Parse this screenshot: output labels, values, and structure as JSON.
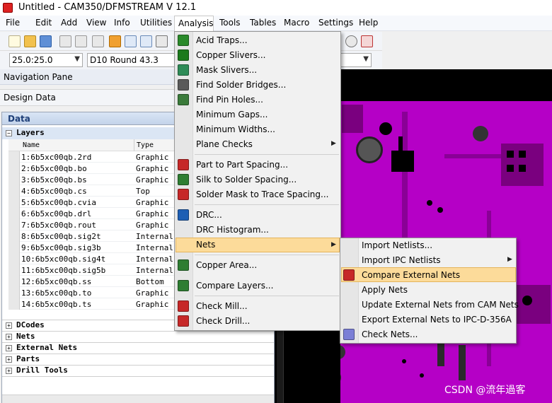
{
  "window": {
    "title": "Untitled - CAM350/DFMSTREAM V 12.1"
  },
  "menubar": {
    "items": [
      "File",
      "Edit",
      "Add",
      "View",
      "Info",
      "Utilities",
      "Analysis",
      "Tools",
      "Tables",
      "Macro",
      "Settings",
      "Help"
    ],
    "active": "Analysis"
  },
  "toolbar": {
    "layer_value": "25.0:25.0",
    "dcode_value": "D10  Round 43.3"
  },
  "navigation": {
    "title": "Navigation Pane",
    "design_data": "Design Data",
    "data_header": "Data"
  },
  "layers": {
    "label": "Layers",
    "columns": [
      "Name",
      "Type"
    ],
    "rows": [
      {
        "name": "1:6b5xc00qb.2rd",
        "type": "Graphic"
      },
      {
        "name": "2:6b5xc00qb.bo",
        "type": "Graphic"
      },
      {
        "name": "3:6b5xc00qb.bs",
        "type": "Graphic"
      },
      {
        "name": "4:6b5xc00qb.cs",
        "type": "Top"
      },
      {
        "name": "5:6b5xc00qb.cvia",
        "type": "Graphic"
      },
      {
        "name": "6:6b5xc00qb.drl",
        "type": "Graphic"
      },
      {
        "name": "7:6b5xc00qb.rout",
        "type": "Graphic"
      },
      {
        "name": "8:6b5xc00qb.sig2t",
        "type": "Internal"
      },
      {
        "name": "9:6b5xc00qb.sig3b",
        "type": "Internal"
      },
      {
        "name": "10:6b5xc00qb.sig4t",
        "type": "Internal"
      },
      {
        "name": "11:6b5xc00qb.sig5b",
        "type": "Internal"
      },
      {
        "name": "12:6b5xc00qb.ss",
        "type": "Bottom"
      },
      {
        "name": "13:6b5xc00qb.to",
        "type": "Graphic"
      },
      {
        "name": "14:6b5xc00qb.ts",
        "type": "Graphic"
      }
    ]
  },
  "tree_groups": [
    "DCodes",
    "Nets",
    "External Nets",
    "Parts",
    "Drill Tools"
  ],
  "analysis_menu": {
    "items": [
      {
        "label": "Acid Traps...",
        "icon": "acid-trap-icon",
        "color": "#2a8a2a"
      },
      {
        "label": "Copper Slivers...",
        "icon": "copper-sliver-icon",
        "color": "#1c7a1c"
      },
      {
        "label": "Mask Slivers...",
        "icon": "mask-sliver-icon",
        "color": "#2e8b57"
      },
      {
        "label": "Find Solder Bridges...",
        "icon": "solder-bridge-icon",
        "color": "#5a5a5a"
      },
      {
        "label": "Find Pin Holes...",
        "icon": "pin-hole-icon",
        "color": "#3a7a3a"
      },
      {
        "label": "Minimum Gaps...",
        "icon": "",
        "color": ""
      },
      {
        "label": "Minimum Widths...",
        "icon": "",
        "color": ""
      },
      {
        "label": "Plane Checks",
        "icon": "",
        "color": ""
      },
      {
        "label": "Part to Part Spacing...",
        "icon": "part-spacing-icon",
        "color": "#c62828"
      },
      {
        "label": "Silk to Solder Spacing...",
        "icon": "silk-solder-icon",
        "color": "#2e7d32"
      },
      {
        "label": "Solder Mask to Trace Spacing...",
        "icon": "mask-trace-icon",
        "color": "#c62828"
      },
      {
        "label": "DRC...",
        "icon": "drc-icon",
        "color": "#1e5fb4"
      },
      {
        "label": "DRC Histogram...",
        "icon": "",
        "color": ""
      },
      {
        "label": "Nets",
        "icon": "",
        "color": ""
      },
      {
        "label": "Copper Area...",
        "icon": "copper-area-icon",
        "color": "#2e7d32"
      },
      {
        "label": "Compare Layers...",
        "icon": "compare-layers-icon",
        "color": "#2e7d32"
      },
      {
        "label": "Check Mill...",
        "icon": "check-mill-icon",
        "color": "#c62828"
      },
      {
        "label": "Check Drill...",
        "icon": "check-drill-icon",
        "color": "#c62828"
      }
    ]
  },
  "nets_submenu": {
    "items": [
      {
        "label": "Import Netlists...",
        "icon": ""
      },
      {
        "label": "Import IPC Netlists",
        "icon": ""
      },
      {
        "label": "Compare External Nets",
        "icon": "compare-nets-icon"
      },
      {
        "label": "Apply Nets",
        "icon": ""
      },
      {
        "label": "Update External Nets from CAM Nets",
        "icon": ""
      },
      {
        "label": "Export External Nets to IPC-D-356A",
        "icon": ""
      },
      {
        "label": "Check Nets...",
        "icon": "check-nets-icon"
      }
    ]
  },
  "watermark": "CSDN @流年過客",
  "colors": {
    "board": "#b500c6",
    "highlight": "#fcdb9a",
    "panel_header": "#1e3f78"
  }
}
